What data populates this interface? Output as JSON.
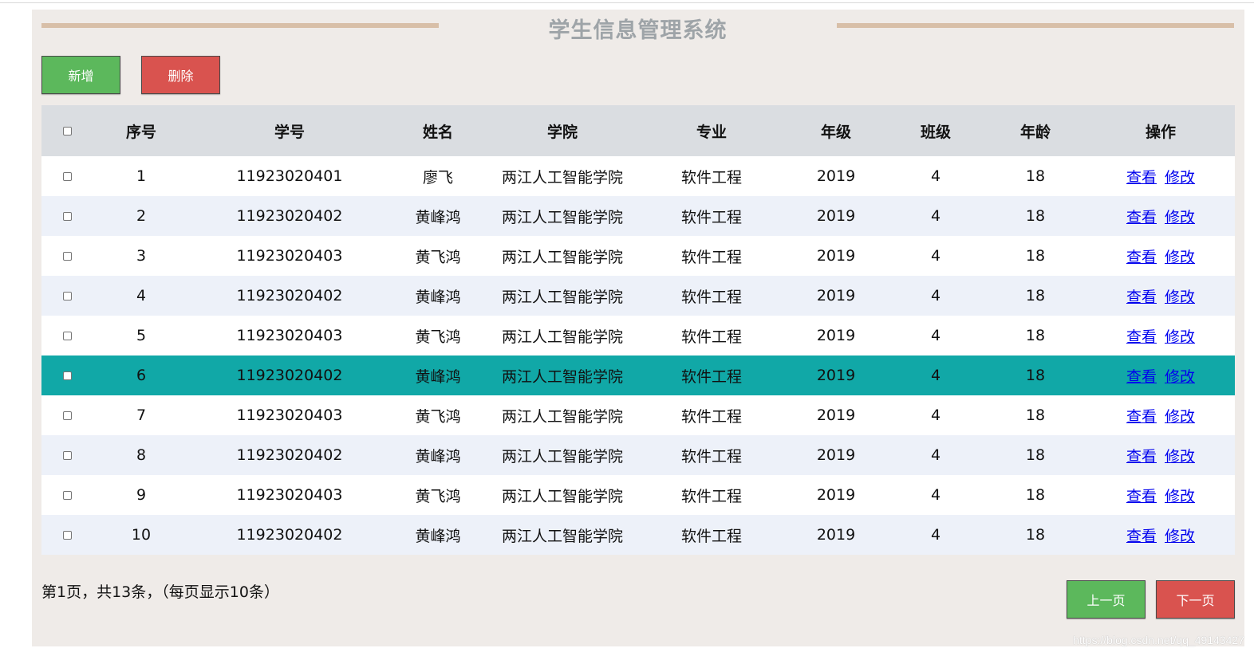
{
  "header": {
    "title": "学生信息管理系统"
  },
  "toolbar": {
    "add_label": "新增",
    "delete_label": "删除"
  },
  "table": {
    "columns": [
      "序号",
      "学号",
      "姓名",
      "学院",
      "专业",
      "年级",
      "班级",
      "年龄",
      "操作"
    ],
    "rows": [
      {
        "seq": "1",
        "id": "11923020401",
        "name": "廖飞",
        "college": "两江人工智能学院",
        "major": "软件工程",
        "grade": "2019",
        "class": "4",
        "age": "18"
      },
      {
        "seq": "2",
        "id": "11923020402",
        "name": "黄峰鸿",
        "college": "两江人工智能学院",
        "major": "软件工程",
        "grade": "2019",
        "class": "4",
        "age": "18"
      },
      {
        "seq": "3",
        "id": "11923020403",
        "name": "黄飞鸿",
        "college": "两江人工智能学院",
        "major": "软件工程",
        "grade": "2019",
        "class": "4",
        "age": "18"
      },
      {
        "seq": "4",
        "id": "11923020402",
        "name": "黄峰鸿",
        "college": "两江人工智能学院",
        "major": "软件工程",
        "grade": "2019",
        "class": "4",
        "age": "18"
      },
      {
        "seq": "5",
        "id": "11923020403",
        "name": "黄飞鸿",
        "college": "两江人工智能学院",
        "major": "软件工程",
        "grade": "2019",
        "class": "4",
        "age": "18"
      },
      {
        "seq": "6",
        "id": "11923020402",
        "name": "黄峰鸿",
        "college": "两江人工智能学院",
        "major": "软件工程",
        "grade": "2019",
        "class": "4",
        "age": "18"
      },
      {
        "seq": "7",
        "id": "11923020403",
        "name": "黄飞鸿",
        "college": "两江人工智能学院",
        "major": "软件工程",
        "grade": "2019",
        "class": "4",
        "age": "18"
      },
      {
        "seq": "8",
        "id": "11923020402",
        "name": "黄峰鸿",
        "college": "两江人工智能学院",
        "major": "软件工程",
        "grade": "2019",
        "class": "4",
        "age": "18"
      },
      {
        "seq": "9",
        "id": "11923020403",
        "name": "黄飞鸿",
        "college": "两江人工智能学院",
        "major": "软件工程",
        "grade": "2019",
        "class": "4",
        "age": "18"
      },
      {
        "seq": "10",
        "id": "11923020402",
        "name": "黄峰鸿",
        "college": "两江人工智能学院",
        "major": "软件工程",
        "grade": "2019",
        "class": "4",
        "age": "18"
      }
    ],
    "view_label": "查看",
    "edit_label": "修改",
    "highlighted_row": 5
  },
  "pagination": {
    "info": "第1页，共13条，（每页显示10条）",
    "prev_label": "上一页",
    "next_label": "下一页"
  },
  "watermark": "https://blog.csdn.net/qq_49143427",
  "colors": {
    "add": "#5cb85c",
    "delete": "#d9534f",
    "highlight": "#11a8a7",
    "header_bg": "#dadde1",
    "title_line": "#d8bfa8"
  }
}
